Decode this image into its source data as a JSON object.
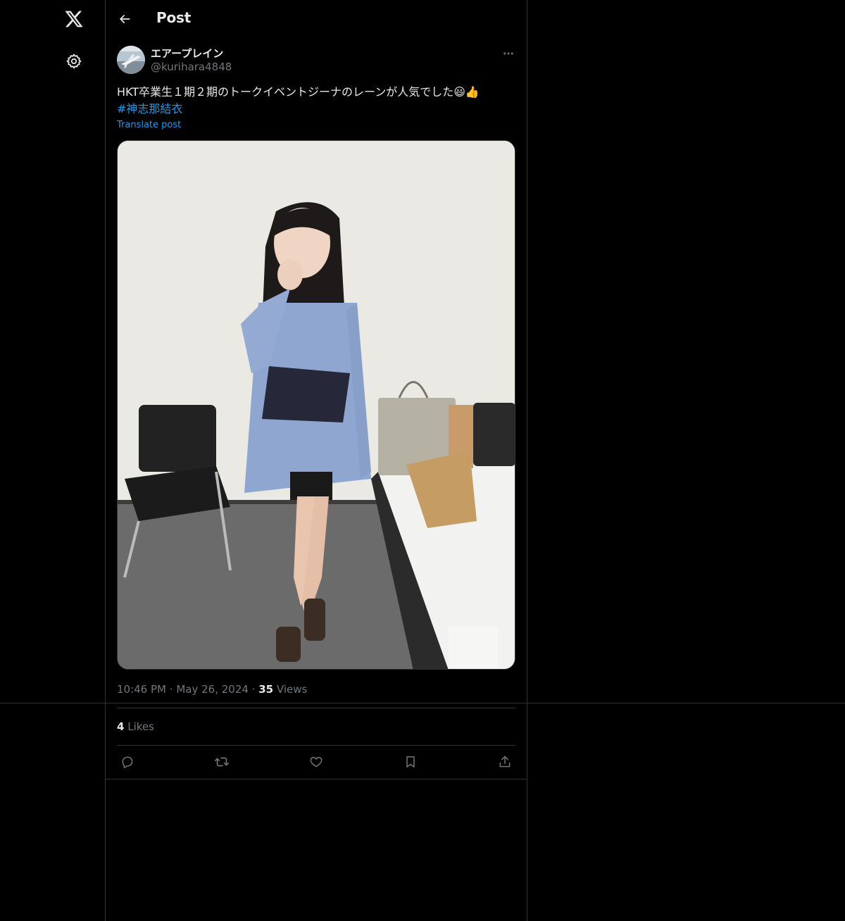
{
  "header": {
    "title": "Post"
  },
  "post": {
    "author": {
      "display_name": "エアープレイン",
      "handle": "@kurihara4848"
    },
    "text": "HKT卒業生１期２期のトークイベントジーナのレーンが人気でした😃👍",
    "hashtag": "#神志那結衣",
    "translate_label": "Translate post",
    "time": "10:46 PM",
    "separator": "·",
    "date": "May 26, 2024",
    "views_count": "35",
    "views_label": "Views",
    "likes_count": "4",
    "likes_label": "Likes"
  },
  "icons": {
    "logo": "x-logo-icon",
    "settings": "gear-icon",
    "back": "back-arrow-icon",
    "more": "more-icon",
    "reply": "reply-icon",
    "repost": "repost-icon",
    "like": "heart-icon",
    "bookmark": "bookmark-icon",
    "share": "share-icon"
  },
  "colors": {
    "background": "#000000",
    "text": "#e7e9ea",
    "secondary": "#71767b",
    "accent": "#1d9bf0",
    "border": "#2f3336"
  }
}
